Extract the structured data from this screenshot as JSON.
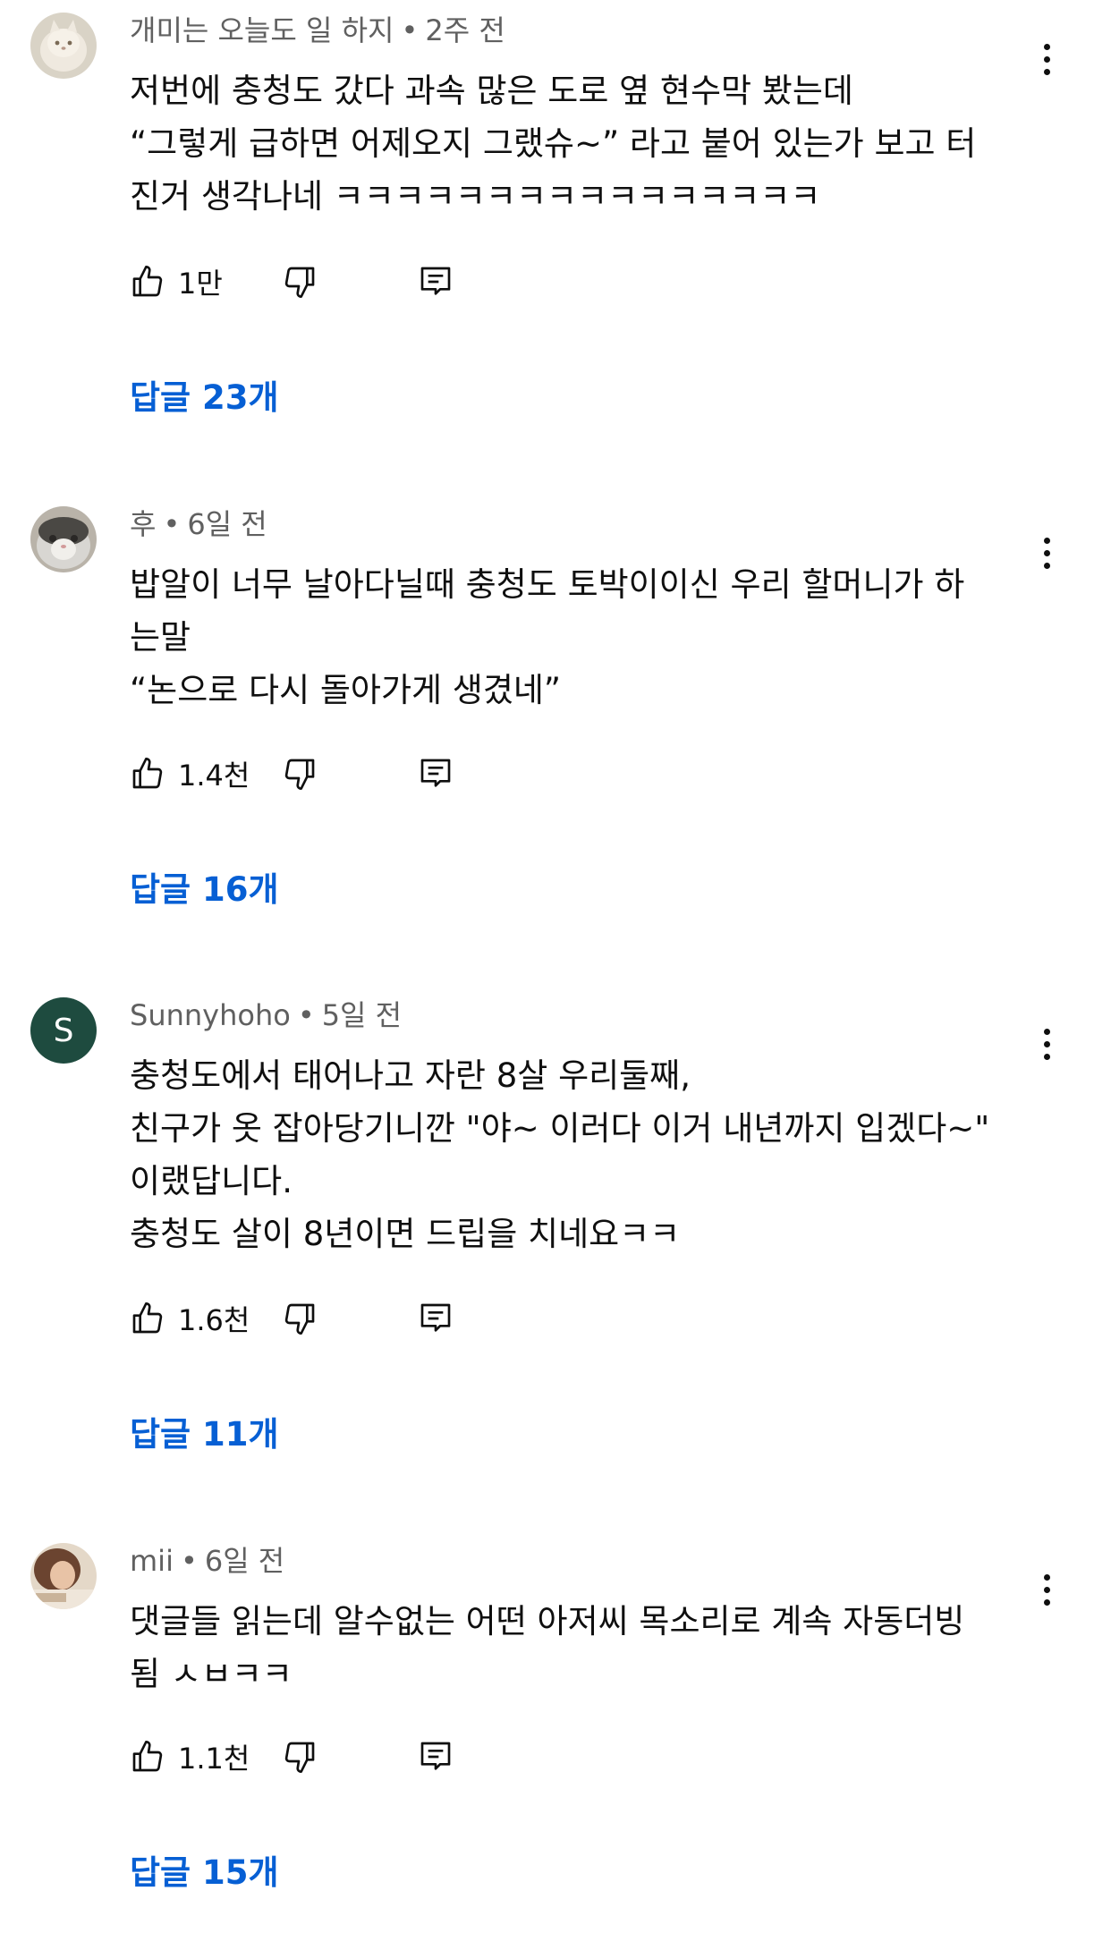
{
  "comments": [
    {
      "author": "개미는 오늘도 일 하지",
      "time": "2주 전",
      "avatar_type": "photo-white-cat",
      "lines": [
        "저번에 충청도 갔다 과속 많은 도로 옆 현수막 봤는데",
        "“그렇게 급하면 어제오지 그랬슈~” 라고 붙어 있는가 보고 터",
        "진거 생각나네 ㅋㅋㅋㅋㅋㅋㅋㅋㅋㅋㅋㅋㅋㅋㅋㅋ"
      ],
      "likes": "1만",
      "replies_label": "답글 23개"
    },
    {
      "author": "후",
      "time": "6일 전",
      "avatar_type": "photo-cat",
      "lines": [
        "밥알이 너무 날아다닐때 충청도 토박이이신 우리 할머니가 하",
        "는말",
        "“논으로 다시 돌아가게 생겼네”"
      ],
      "likes": "1.4천",
      "replies_label": "답글 16개"
    },
    {
      "author": "Sunnyhoho",
      "time": "5일 전",
      "avatar_type": "letter",
      "avatar_letter": "S",
      "avatar_color": "#1e4b3f",
      "lines": [
        "충청도에서 태어나고 자란 8살 우리둘째,",
        "친구가 옷 잡아당기니깐 \"야~ 이러다 이거 내년까지 입겠다~\"",
        "이랬답니다.",
        "충청도 살이 8년이면 드립을 치네요ㅋㅋ"
      ],
      "likes": "1.6천",
      "replies_label": "답글 11개"
    },
    {
      "author": "mii",
      "time": "6일 전",
      "avatar_type": "photo-person",
      "lines": [
        "댓글들 읽는데 알수없는 어떤 아저씨 목소리로 계속 자동더빙",
        "됨 ㅅㅂㅋㅋ"
      ],
      "likes": "1.1천",
      "replies_label": "답글 15개"
    }
  ],
  "icons": {
    "like": "thumbs-up-icon",
    "dislike": "thumbs-down-icon",
    "reply": "comment-reply-icon",
    "more": "more-vertical-icon"
  },
  "colors": {
    "text": "#0f0f0f",
    "meta": "#606060",
    "link": "#065fd4"
  }
}
